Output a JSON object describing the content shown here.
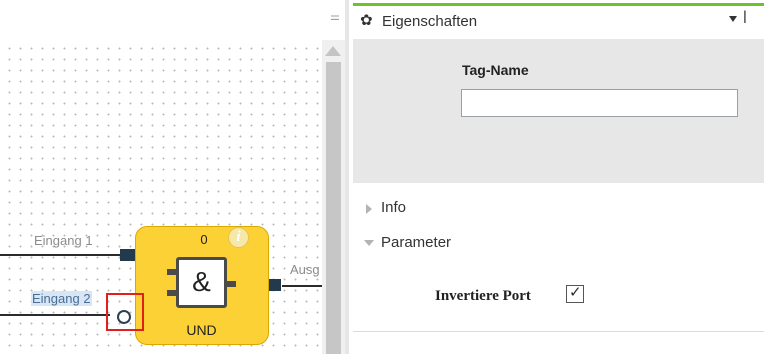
{
  "toolbar": {
    "menu_glyph": "⚌"
  },
  "diagram": {
    "inputs": [
      {
        "label": "Eingang 1"
      },
      {
        "label": "Eingang 2"
      }
    ],
    "gate": {
      "count": "0",
      "symbol": "&",
      "name": "UND",
      "info_icon_text": "i"
    },
    "output_label": "Ausg"
  },
  "properties": {
    "title": "Eigenschaften",
    "gear_icon": "✿",
    "pin_icon": "ꟾ",
    "tag_name_label": "Tag-Name",
    "tag_name_value": "",
    "sections": [
      {
        "label": "Info",
        "expanded": false
      },
      {
        "label": "Parameter",
        "expanded": true
      }
    ],
    "parameter": {
      "label": "Invertiere Port",
      "checked": true,
      "check_glyph": "✓"
    }
  },
  "colors": {
    "accent_green": "#6cc42b",
    "gate_yellow": "#fbd136",
    "selection_red": "#e0201c"
  }
}
